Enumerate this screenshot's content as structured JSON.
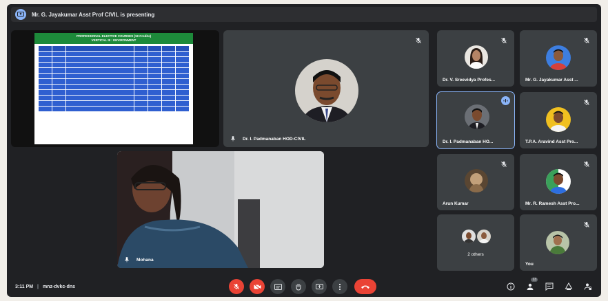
{
  "presenting_banner": "Mr. G. Jayakumar Asst Prof CIVIL is presenting",
  "slide": {
    "title_line1": "PROFESSIONAL ELECTIVE COURSES (18 Credits)",
    "title_line2": "VERTICAL III : ENVIRONMENT"
  },
  "participants": {
    "main": "Dr. I. Padmanaban HOD-CIVIL",
    "mohana": "Mohana",
    "sreevidya": "Dr. V. Sreevidya Profes...",
    "jayakumar": "Mr. G. Jayakumar Asst ...",
    "padmanaban_small": "Dr. I. Padmanaban HO...",
    "aravind": "T.P.A. Aravind Asst Pro...",
    "arun": "Arun Kumar",
    "ramesh": "Mr. R. Ramesh Asst Pro...",
    "others": "2 others",
    "you": "You"
  },
  "meeting": {
    "time": "3:11 PM",
    "separator": "|",
    "code": "mnz-dvkc-dns"
  },
  "badge_count": "13",
  "colors": {
    "frame_bg": "#202124",
    "tile_bg": "#3c4043",
    "red": "#ea4335",
    "accent": "#8ab4f8"
  }
}
